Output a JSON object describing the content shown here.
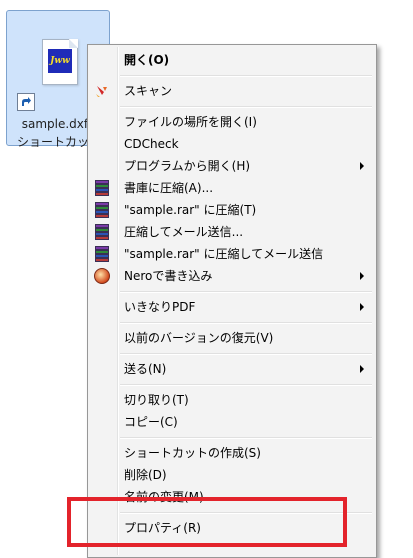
{
  "desktop_item": {
    "label_line1": "sample.dxf -",
    "label_line2": "ショートカット",
    "app_badge": "Jww"
  },
  "menu": {
    "open": "開く(O)",
    "scan": "スキャン",
    "open_file_location": "ファイルの場所を開く(I)",
    "cdcheck": "CDCheck",
    "open_with": "プログラムから開く(H)",
    "add_to_archive": "書庫に圧縮(A)...",
    "add_to_rar": "\"sample.rar\" に圧縮(T)",
    "compress_email": "圧縮してメール送信...",
    "compress_rar_email": "\"sample.rar\" に圧縮してメール送信",
    "nero_burn": "Neroで書き込み",
    "ikinari_pdf": "いきなりPDF",
    "restore_previous": "以前のバージョンの復元(V)",
    "send_to": "送る(N)",
    "cut": "切り取り(T)",
    "copy": "コピー(C)",
    "create_shortcut": "ショートカットの作成(S)",
    "delete": "削除(D)",
    "rename": "名前の変更(M)",
    "properties": "プロパティ(R)"
  },
  "colors": {
    "highlight": "#e3232b",
    "selection_bg": "#cfe3fb",
    "menu_bg": "#f3f3f3"
  }
}
